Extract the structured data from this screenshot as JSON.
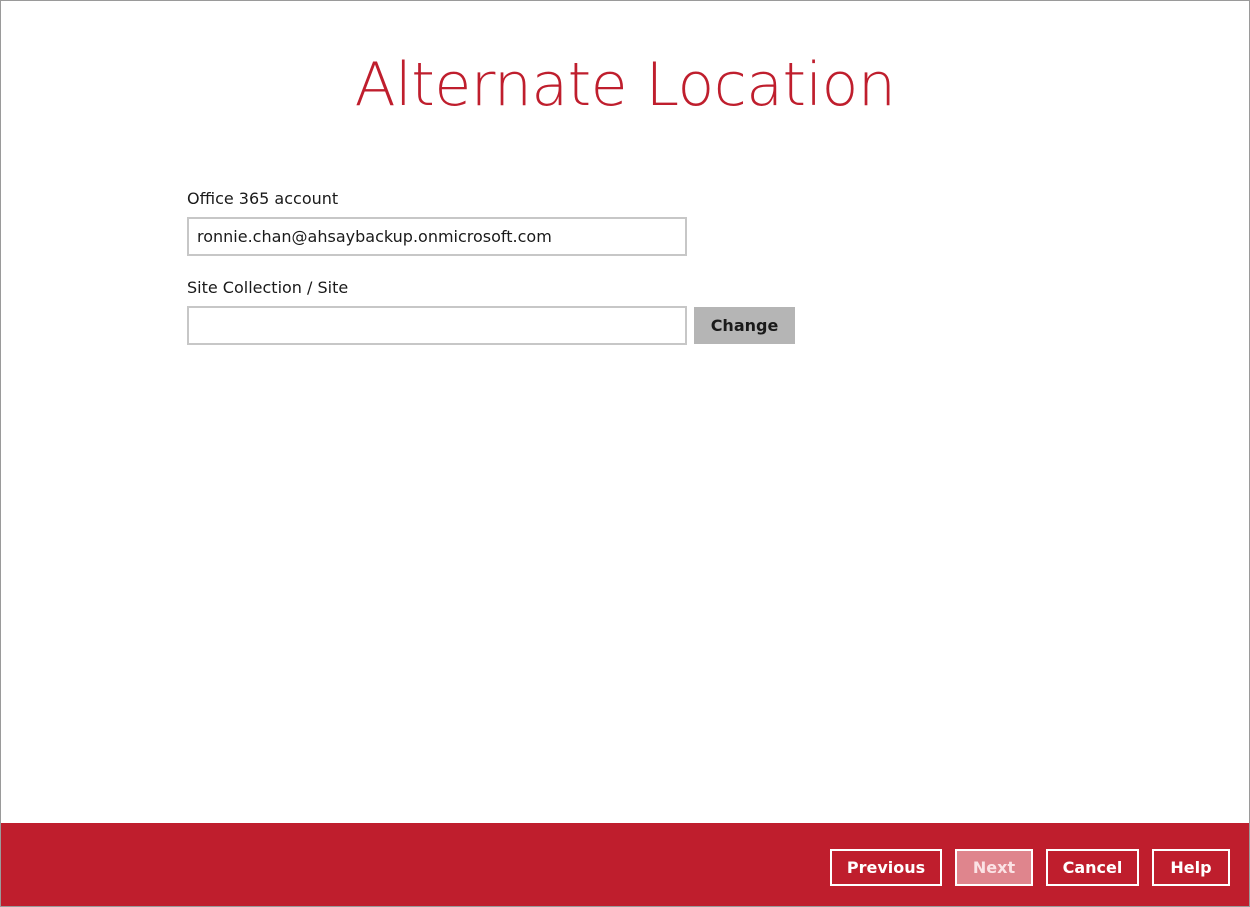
{
  "page": {
    "title": "Alternate Location"
  },
  "form": {
    "account_label": "Office 365 account",
    "account_value": "ronnie.chan@ahsaybackup.onmicrosoft.com",
    "site_label": "Site Collection / Site",
    "site_value": "",
    "change_label": "Change"
  },
  "footer": {
    "previous_label": "Previous",
    "next_label": "Next",
    "next_state": "disabled",
    "cancel_label": "Cancel",
    "help_label": "Help"
  },
  "colors": {
    "brand_red": "#bf1e2d",
    "disabled_button": "#df858d",
    "secondary_button": "#b5b5b5"
  }
}
